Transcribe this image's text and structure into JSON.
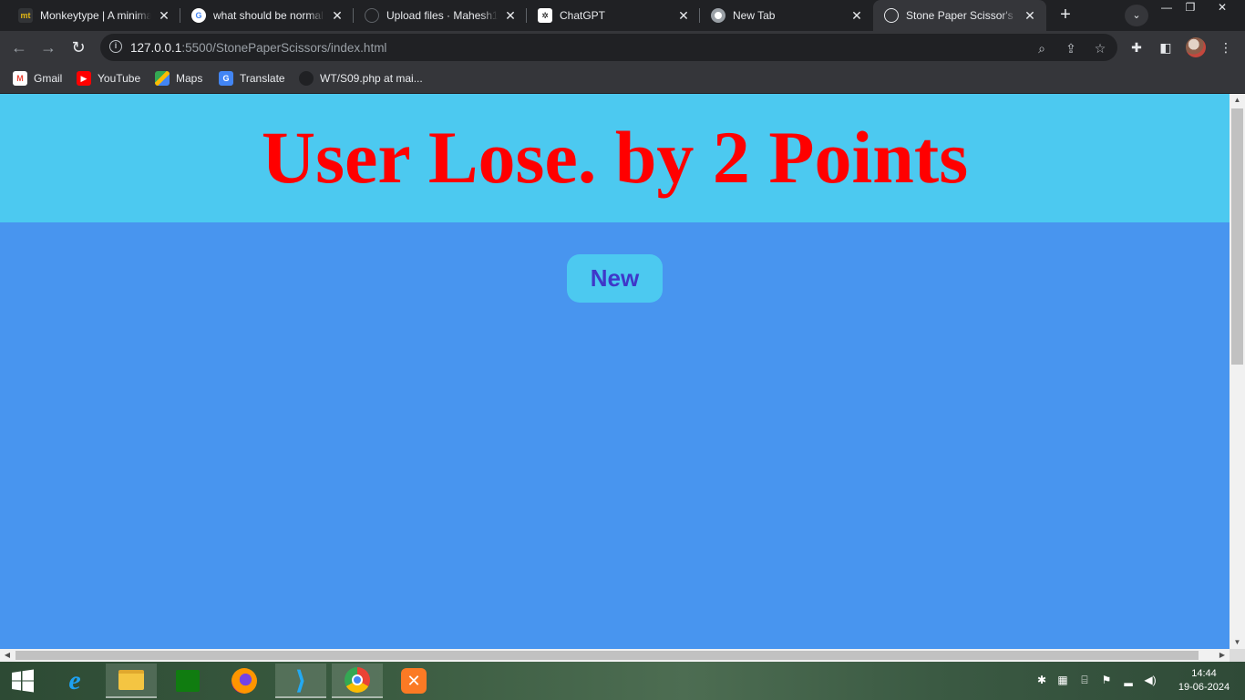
{
  "browser": {
    "tabs": [
      {
        "title": "Monkeytype | A minimalistic",
        "favicon": "mt",
        "active": false
      },
      {
        "title": "what should be normal",
        "favicon": "G",
        "active": false
      },
      {
        "title": "Upload files · Mahesh17",
        "favicon": "github",
        "active": false
      },
      {
        "title": "ChatGPT",
        "favicon": "chatgpt",
        "active": false
      },
      {
        "title": "New Tab",
        "favicon": "chrome",
        "active": false
      },
      {
        "title": "Stone Paper Scissor's",
        "favicon": "globe",
        "active": true
      }
    ],
    "url_host": "127.0.0.1",
    "url_path": ":5500/StonePaperScissors/index.html",
    "bookmarks": [
      {
        "label": "Gmail"
      },
      {
        "label": "YouTube"
      },
      {
        "label": "Maps"
      },
      {
        "label": "Translate"
      },
      {
        "label": "WT/S09.php at mai..."
      }
    ]
  },
  "page": {
    "result_text": "User Lose. by 2 Points",
    "new_button_label": "New",
    "colors": {
      "banner": "#4cc9f0",
      "background": "#4895ef",
      "result": "#ff0000",
      "button_text": "#3f37c9"
    }
  },
  "taskbar": {
    "time": "14:44",
    "date": "19-06-2024"
  }
}
